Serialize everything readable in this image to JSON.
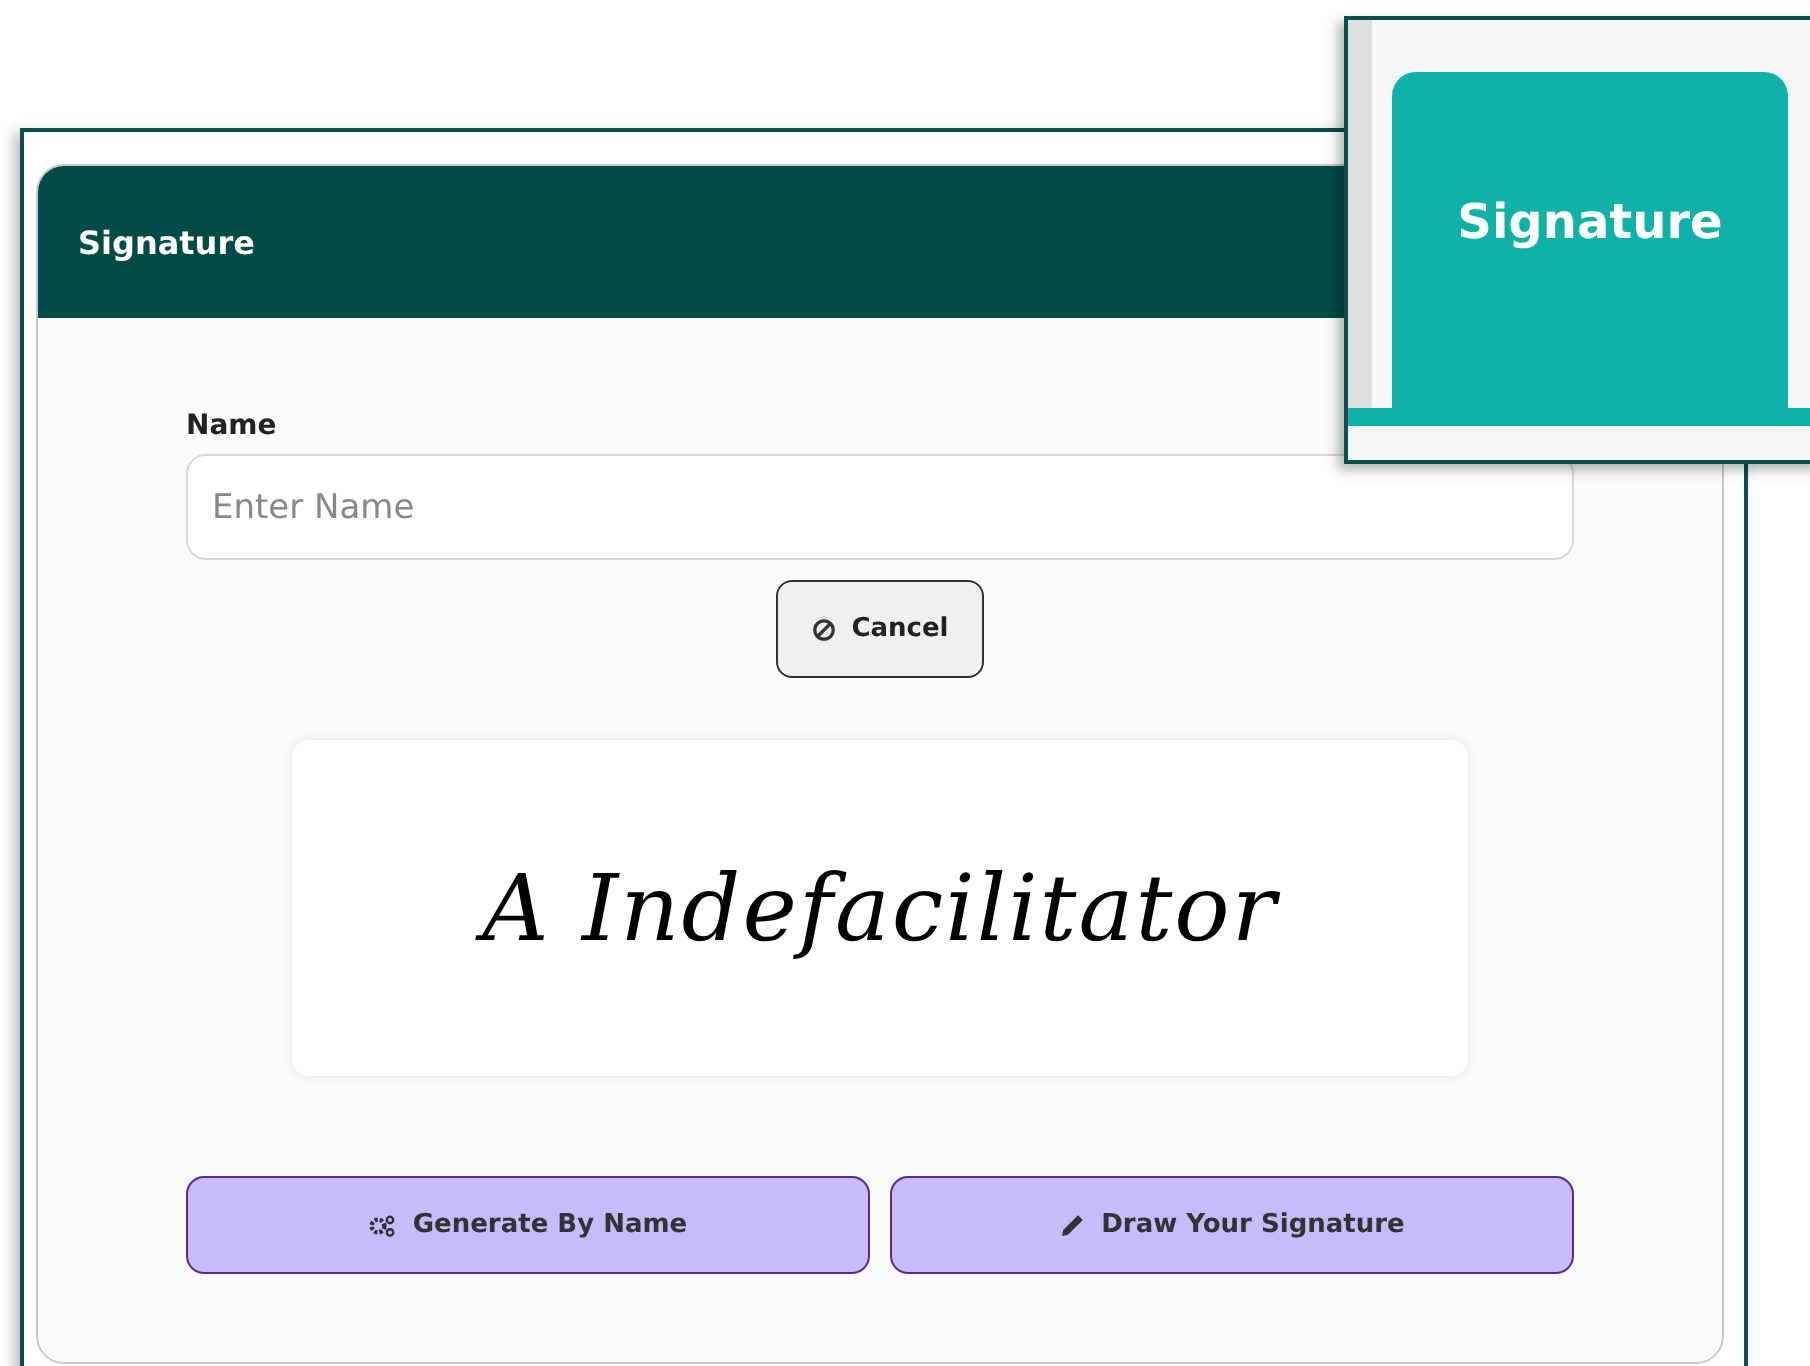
{
  "dialog": {
    "title": "Signature"
  },
  "name_field": {
    "label": "Name",
    "placeholder": "Enter Name"
  },
  "cancel_button": {
    "label": "Cancel"
  },
  "signature_preview": {
    "text": "A Indefacilitator"
  },
  "action_buttons": [
    {
      "label": "Generate By Name",
      "kind": "generate"
    },
    {
      "label": "Draw Your Signature",
      "kind": "draw"
    }
  ],
  "zoom_inset": {
    "tab": {
      "label": "Signature",
      "selected": true
    }
  }
}
